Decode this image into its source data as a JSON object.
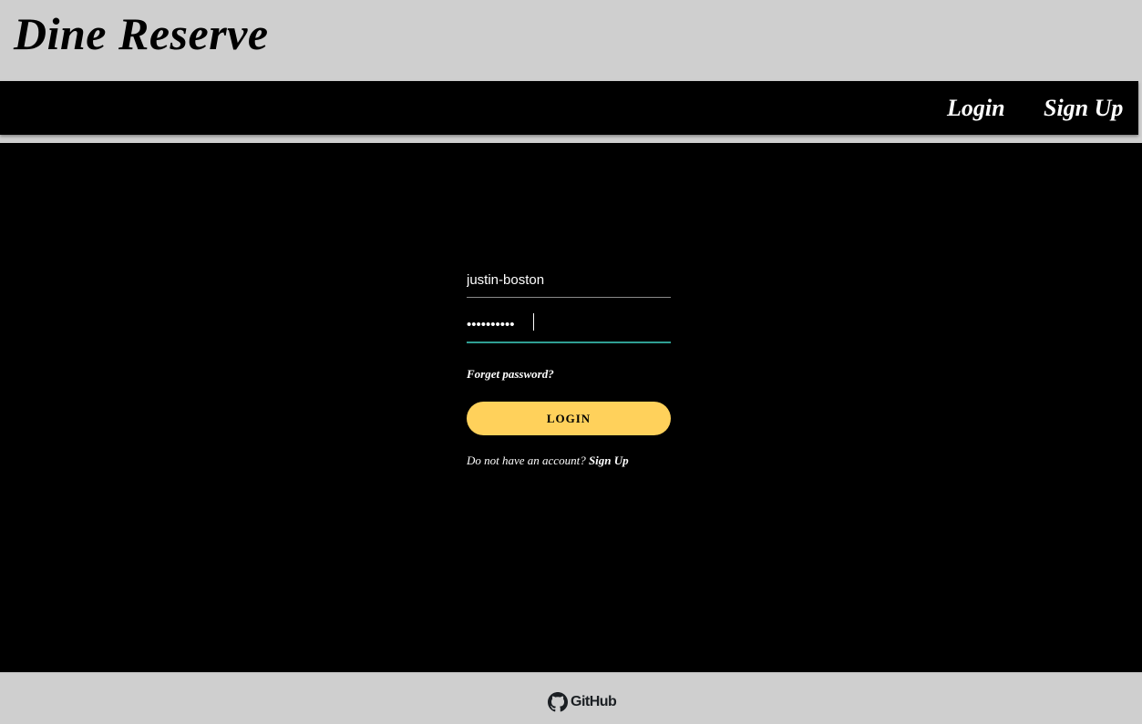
{
  "header": {
    "brand": "Dine Reserve"
  },
  "nav": {
    "login_label": "Login",
    "signup_label": "Sign Up"
  },
  "login_form": {
    "username_value": "justin-boston",
    "password_value": "••••••••••",
    "forgot_label": "Forget password?",
    "submit_label": "LOGIN",
    "no_account_text": "Do not have an account? ",
    "signup_link_label": "Sign Up"
  },
  "footer": {
    "github_label": "GitHub",
    "github_icon": "github-icon"
  },
  "colors": {
    "page_bg": "#cfcfcf",
    "main_bg": "#000000",
    "accent_button": "#ffd15b",
    "focus_underline": "#2f9f93"
  }
}
